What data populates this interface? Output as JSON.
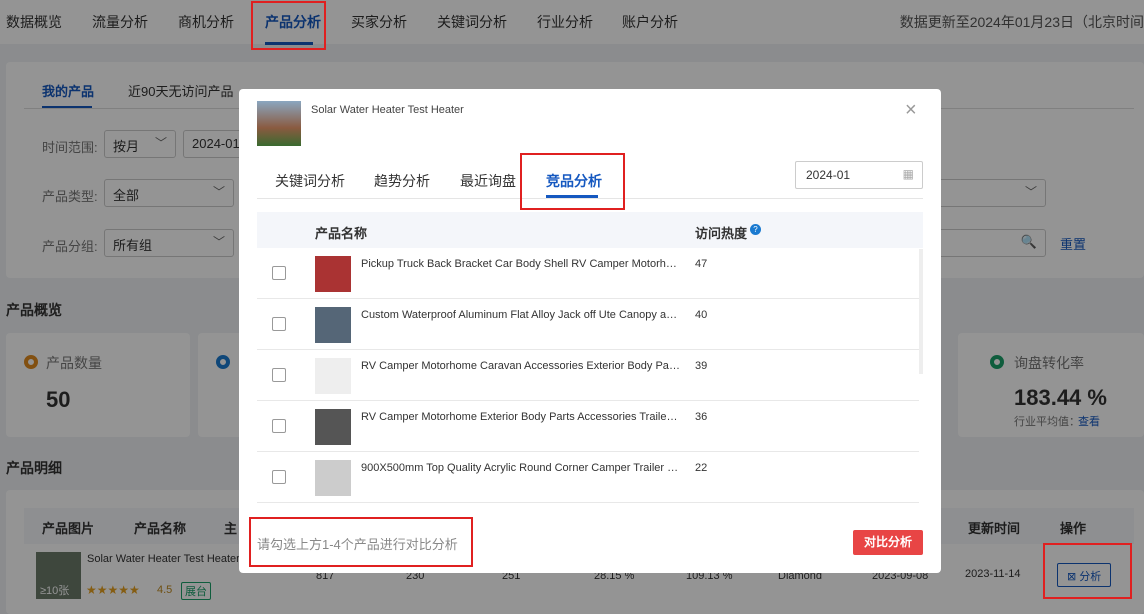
{
  "topnav": {
    "items": [
      "数据概览",
      "流量分析",
      "商机分析",
      "产品分析",
      "买家分析",
      "关键词分析",
      "行业分析",
      "账户分析"
    ],
    "active": "产品分析",
    "update_text": "数据更新至2024年01月23日（北京时间"
  },
  "subtabs": [
    "我的产品",
    "近90天无访问产品"
  ],
  "filters": {
    "time_label": "时间范围:",
    "time_mode": "按月",
    "time_value": "2024-01",
    "type_label": "产品类型:",
    "type_value": "全部",
    "group_label": "产品分组:",
    "group_value": "所有组",
    "reset": "重置"
  },
  "overview": {
    "title": "产品概览",
    "cards": [
      {
        "label": "产品数量",
        "value": "50",
        "color": "#e08a1e"
      },
      {
        "label": "询盘转化率",
        "value": "183.44 %",
        "sub_label": "行业平均值：",
        "sub_link": "查看",
        "color": "#1aa06a"
      }
    ]
  },
  "detail": {
    "title": "产品明细",
    "columns": [
      "产品图片",
      "产品名称",
      "主",
      "更新时间",
      "操作"
    ],
    "row": {
      "name": "Solar Water Heater Test Heater",
      "img_count": "≥10张",
      "rating": "4.5",
      "badge": "展台",
      "values": [
        "817",
        "230",
        "251",
        "28.15 %",
        "109.13 %",
        "Diamond",
        "2023-09-08",
        "2023-11-14"
      ],
      "action": "分析"
    }
  },
  "modal": {
    "product": "Solar Water Heater Test Heater",
    "tabs": [
      "关键词分析",
      "趋势分析",
      "最近询盘",
      "竞品分析"
    ],
    "active_tab": "竞品分析",
    "date": "2024-01",
    "columns": {
      "name": "产品名称",
      "heat": "访问热度"
    },
    "rows": [
      {
        "name": "Pickup Truck Back Bracket Car Body Shell RV Camper Motorho...",
        "heat": "47"
      },
      {
        "name": "Custom Waterproof Aluminum Flat Alloy Jack off Ute Canopy an...",
        "heat": "40"
      },
      {
        "name": "RV Camper Motorhome Caravan Accessories Exterior Body Part...",
        "heat": "39"
      },
      {
        "name": "RV Camper Motorhome Exterior Body Parts Accessories Trailer ...",
        "heat": "36"
      },
      {
        "name": "900X500mm Top Quality Acrylic Round Corner Camper Trailer Si...",
        "heat": "22"
      }
    ],
    "hint": "请勾选上方1-4个产品进行对比分析",
    "compare": "对比分析"
  },
  "colors": {
    "accent": "#1558c0",
    "danger": "#e84545",
    "highlight": "#e02020"
  }
}
